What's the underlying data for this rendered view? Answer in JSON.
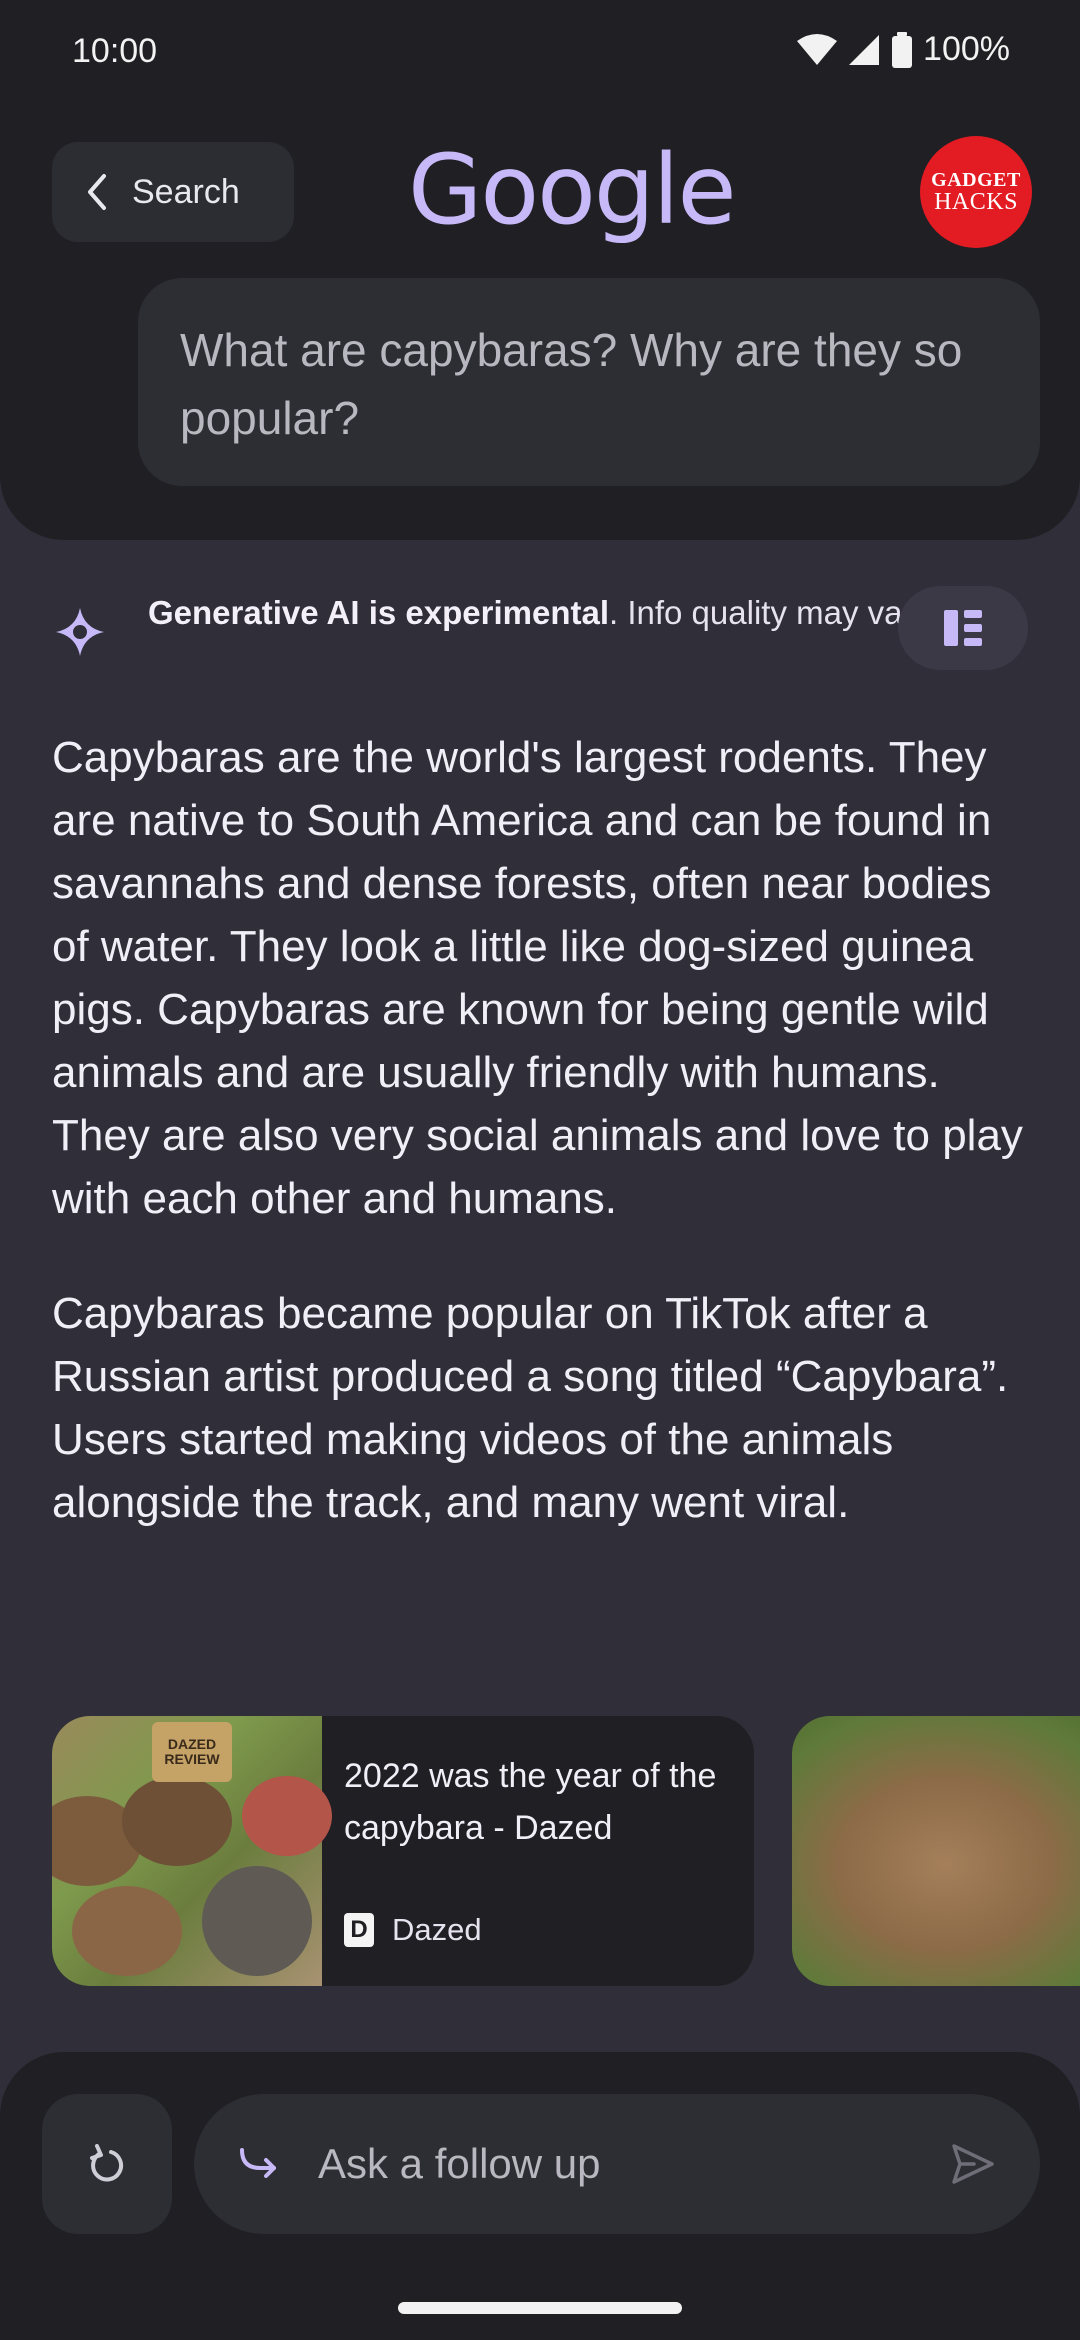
{
  "status": {
    "time": "10:00",
    "battery": "100%"
  },
  "header": {
    "back_label": "Search",
    "logo_text": "Google",
    "avatar_line1": "GADGET",
    "avatar_line2": "HACKS",
    "query": "What are capybaras? Why are they so popular?"
  },
  "disclaimer": {
    "bold": "Generative AI is experimental",
    "rest": ". Info quality may vary."
  },
  "answer": {
    "paragraphs": [
      "Capybaras are the world's largest rodents. They are native to South America and can be found in savannahs and dense forests, often near bodies of water. They look a little like dog-sized guinea pigs. Capybaras are known for being gentle wild animals and are usually friendly with humans. They are also very social animals and love to play with each other and humans.",
      "Capybaras became popular on TikTok after a Russian artist produced a song titled “Capybara”. Users started making videos of the animals alongside the track, and many went viral."
    ]
  },
  "cards": [
    {
      "title": "2022 was the year of the capybara - Dazed",
      "source": "Dazed",
      "favicon_letter": "D",
      "thumb_banner": "DAZED REVIEW"
    }
  ],
  "followup": {
    "placeholder": "Ask a follow up"
  },
  "icons": {
    "back": "chevron-left-icon",
    "spark": "spark-icon",
    "sources": "sources-list-icon",
    "refresh": "refresh-icon",
    "followup": "follow-up-arrow-icon",
    "send": "send-icon"
  },
  "colors": {
    "background": "#2f2e39",
    "surface": "#1f1f24",
    "accent": "#c7b9f7",
    "avatar": "#e31b23"
  }
}
